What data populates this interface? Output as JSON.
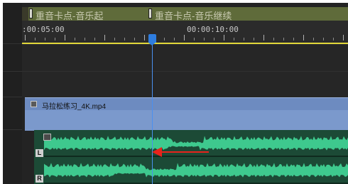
{
  "markers": [
    {
      "label": "重音卡点-音乐起"
    },
    {
      "label": "重音卡点-音乐继续"
    }
  ],
  "ruler": {
    "timecodes": [
      ":00:05:00",
      "00:00:10:00"
    ]
  },
  "video_clip": {
    "name": "马拉松练习_4K.mp4"
  },
  "audio_clip": {
    "channels": [
      "L",
      "R"
    ]
  },
  "colors": {
    "marker": "#5f6b3a",
    "work_area": "#e2d93a",
    "playhead": "#2e7de0",
    "video_clip": "#7b99cc",
    "audio_clip": "#1c4a36",
    "waveform": "#3ec98e",
    "annotation_arrow": "#e8231b"
  }
}
